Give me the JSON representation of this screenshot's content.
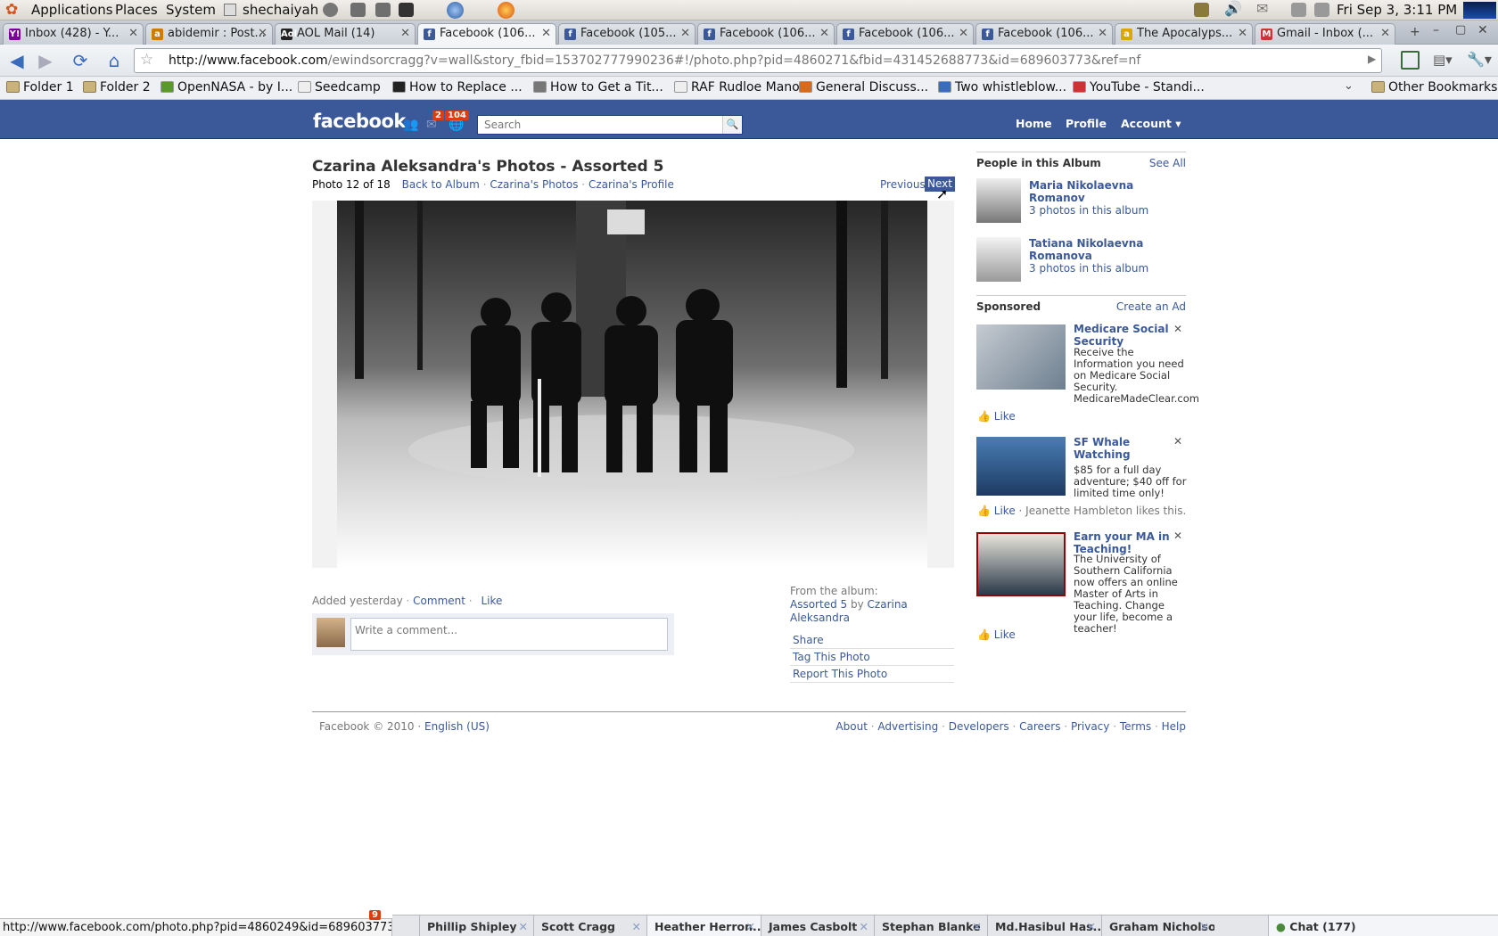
{
  "gnome_panel": {
    "menus": [
      "Applications",
      "Places",
      "System"
    ],
    "user": "shechaiyah",
    "clock": "Fri Sep  3,  3:11 PM"
  },
  "browser": {
    "tabs": [
      {
        "title": "Inbox (428) - Y...",
        "favicon": "Y!",
        "color": "#7b0099"
      },
      {
        "title": "abidemir : Post...",
        "favicon": "a",
        "color": "#d07a00"
      },
      {
        "title": "AOL Mail (14)",
        "favicon": "Aol",
        "color": "#222"
      },
      {
        "title": "Facebook (106...",
        "favicon": "f",
        "color": "#3b5998",
        "active": true
      },
      {
        "title": "Facebook (105...",
        "favicon": "f",
        "color": "#3b5998"
      },
      {
        "title": "Facebook (106...",
        "favicon": "f",
        "color": "#3b5998"
      },
      {
        "title": "Facebook (106...",
        "favicon": "f",
        "color": "#3b5998"
      },
      {
        "title": "Facebook (106...",
        "favicon": "f",
        "color": "#3b5998"
      },
      {
        "title": "The Apocalyps...",
        "favicon": "a",
        "color": "#d8a800"
      },
      {
        "title": "Gmail - Inbox (...",
        "favicon": "M",
        "color": "#c33"
      }
    ],
    "url_host": "http://www.facebook.com",
    "url_path": "/ewindsorcragg?v=wall&story_fbid=153702777990236#!/photo.php?pid=4860271&fbid=431452688773&id=689603773&ref=nf",
    "bookmarks": [
      "Folder 1",
      "Folder 2",
      "OpenNASA - by I...",
      "Seedcamp",
      "How to Replace ...",
      "How to Get a Tit...",
      "RAF Rudloe Manor",
      "General Discuss...",
      "Two whistleblow...",
      "YouTube - Standi..."
    ],
    "other_bookmarks": "Other Bookmarks",
    "status_url": "http://www.facebook.com/photo.php?pid=4860249&id=689603773"
  },
  "facebook": {
    "logo": "facebook",
    "badges": {
      "messages": "2",
      "notifications": "104"
    },
    "search_placeholder": "Search",
    "nav": {
      "home": "Home",
      "profile": "Profile",
      "account": "Account ▾"
    },
    "page_title": "Czarina Aleksandra's Photos - Assorted 5",
    "photo_counter": "Photo 12 of 18",
    "links": {
      "back_to_album": "Back to Album",
      "photos": "Czarina's Photos",
      "profile": "Czarina's Profile"
    },
    "pager": {
      "previous": "Previous",
      "next": "Next"
    },
    "meta": {
      "added": "Added yesterday",
      "comment": "Comment",
      "like": "Like"
    },
    "comment_placeholder": "Write a comment...",
    "album": {
      "from": "From the album:",
      "name": "Assorted 5",
      "by": "by",
      "owner": "Czarina Aleksandra"
    },
    "actions": [
      "Share",
      "Tag This Photo",
      "Report This Photo"
    ],
    "sidebar": {
      "people_title": "People in this Album",
      "see_all": "See All",
      "people": [
        {
          "name": "Maria Nikolaevna Romanov",
          "count": "3 photos in this album"
        },
        {
          "name": "Tatiana Nikolaevna Romanova",
          "count": "3 photos in this album"
        }
      ],
      "sponsored": "Sponsored",
      "create_ad": "Create an Ad",
      "ads": [
        {
          "title": "Medicare Social Security",
          "body": "Receive the Information you need on Medicare Social Security. MedicareMadeClear.com",
          "like": "Like",
          "social": ""
        },
        {
          "title": "SF Whale Watching",
          "body": "$85 for a full day adventure; $40 off for limited time only!",
          "like": "Like",
          "social": "· Jeanette Hambleton likes this."
        },
        {
          "title": "Earn your MA in Teaching!",
          "body": "The University of Southern California now offers an online Master of Arts in Teaching. Change your life, become a teacher!",
          "like": "Like",
          "social": ""
        }
      ]
    },
    "footer": {
      "copyright": "Facebook © 2010 ·",
      "language": "English (US)",
      "links": [
        "About",
        "Advertising",
        "Developers",
        "Careers",
        "Privacy",
        "Terms",
        "Help"
      ]
    },
    "chat": {
      "friends": [
        "Phillip Shipley",
        "Scott Cragg",
        "Heather Herron...",
        "James Casbolt",
        "Stephan Blanke",
        "Md.Hasibul Has...",
        "Graham Nicholson"
      ],
      "notice_count": "9",
      "label": "Chat (177)"
    }
  }
}
